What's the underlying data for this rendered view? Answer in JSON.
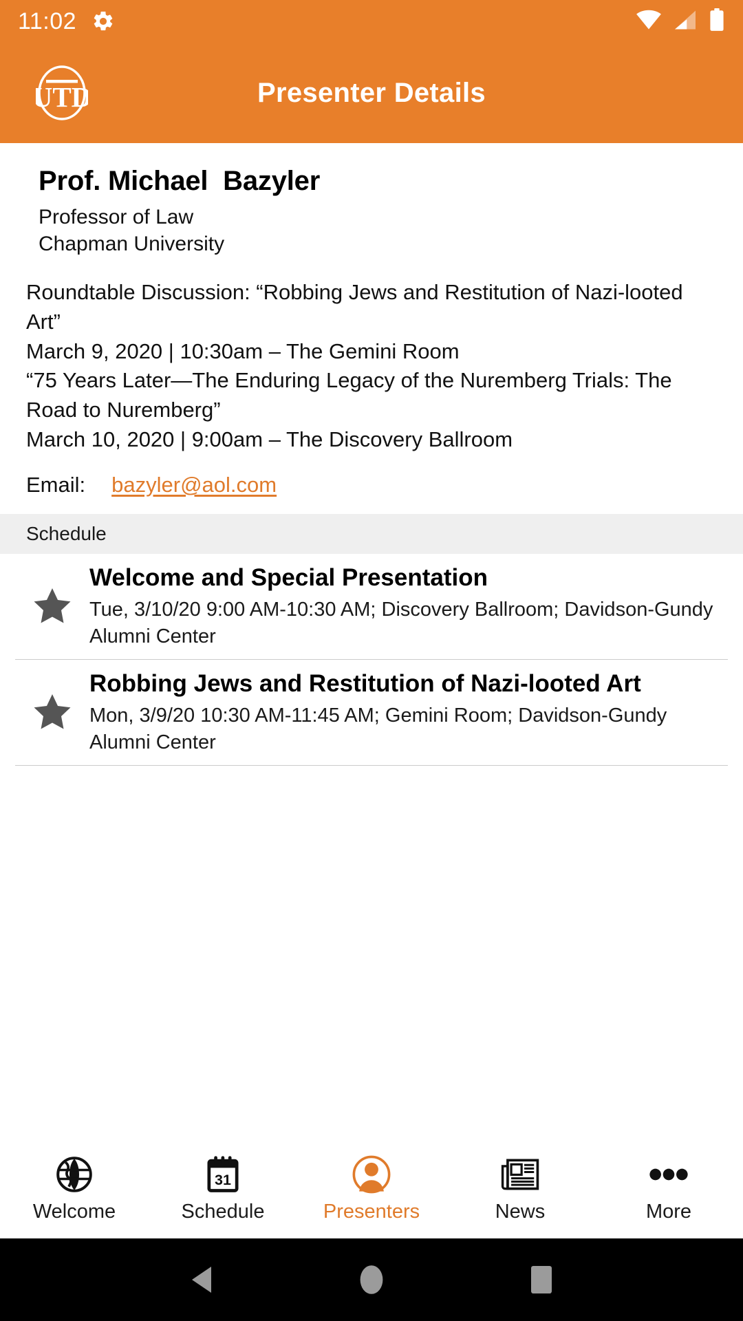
{
  "status_bar": {
    "time": "11:02",
    "gear_icon": "gear-icon",
    "wifi_icon": "wifi-icon",
    "cellular_icon": "cellular-signal-icon",
    "battery_icon": "battery-full-icon"
  },
  "app_bar": {
    "logo": "utd-logo",
    "title": "Presenter Details"
  },
  "presenter": {
    "name": "Prof. Michael  Bazyler",
    "title": "Professor of Law",
    "organization": "Chapman University",
    "bio_lines": [
      "Roundtable Discussion: “Robbing Jews and Restitution of Nazi-looted Art”",
      "March 9, 2020 | 10:30am – The Gemini Room",
      "“75 Years Later—The Enduring Legacy of the Nuremberg Trials: The Road to Nuremberg”",
      "March 10, 2020 | 9:00am – The Discovery Ballroom"
    ],
    "email_label": "Email:",
    "email_value": "bazyler@aol.com"
  },
  "schedule_section": {
    "header": "Schedule",
    "items": [
      {
        "star_icon": "star-icon",
        "title": "Welcome and Special Presentation",
        "meta": "Tue, 3/10/20 9:00 AM-10:30 AM; Discovery Ballroom; Davidson-Gundy Alumni Center"
      },
      {
        "star_icon": "star-icon",
        "title": "Robbing Jews and Restitution of Nazi-looted Art",
        "meta": "Mon, 3/9/20 10:30 AM-11:45 AM; Gemini Room; Davidson-Gundy Alumni Center"
      }
    ]
  },
  "tab_bar": {
    "tabs": [
      {
        "label": "Welcome",
        "icon": "globe-icon",
        "active": false
      },
      {
        "label": "Schedule",
        "icon": "calendar-icon",
        "active": false
      },
      {
        "label": "Presenters",
        "icon": "person-icon",
        "active": true
      },
      {
        "label": "News",
        "icon": "newspaper-icon",
        "active": false
      },
      {
        "label": "More",
        "icon": "ellipsis-icon",
        "active": false
      }
    ]
  },
  "android_nav": {
    "back": "back-triangle-icon",
    "home": "home-circle-icon",
    "recents": "recents-square-icon"
  },
  "colors": {
    "brand_orange": "#E87F2A",
    "link_orange": "#E07B2B",
    "section_gray": "#EFEFEF",
    "star_gray": "#555555",
    "divider": "#CBCBCB"
  }
}
